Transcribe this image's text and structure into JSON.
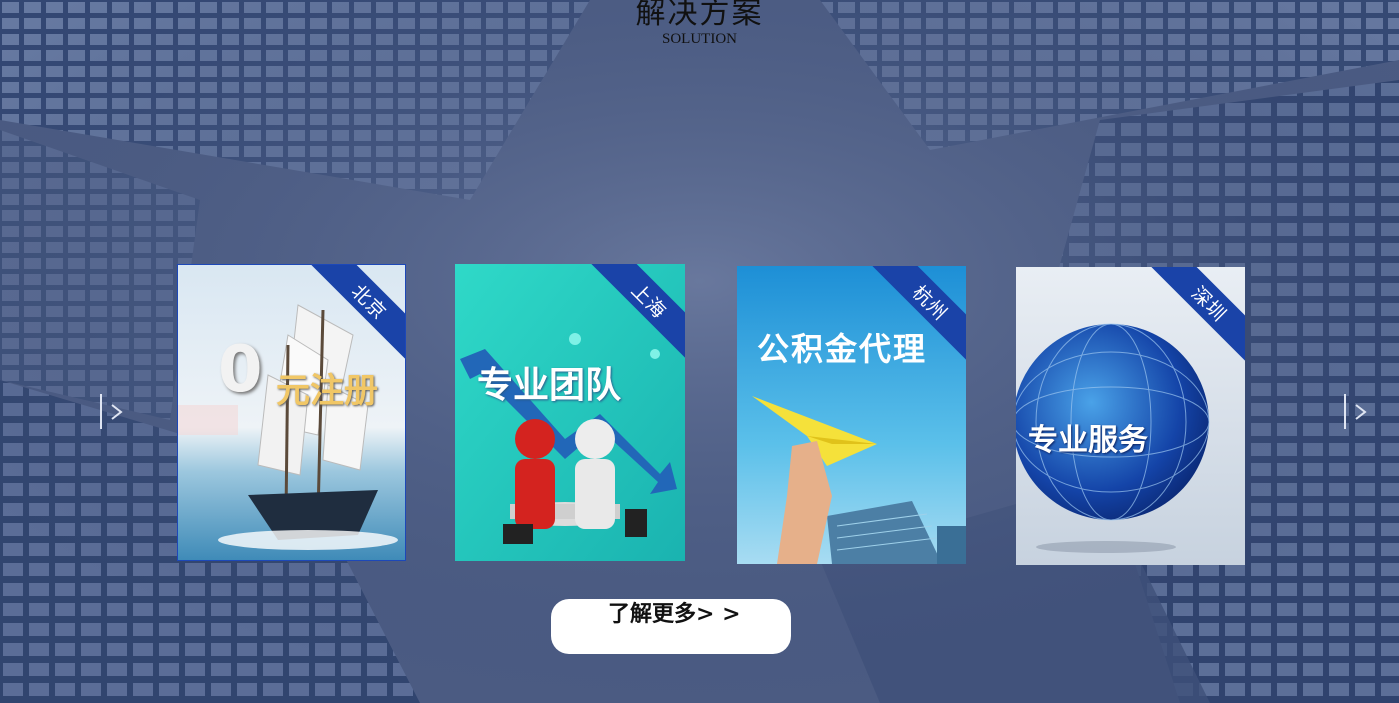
{
  "section": {
    "title": "解决方案",
    "subtitle": "SOLUTION"
  },
  "cards": [
    {
      "city": "北京",
      "caption_prefix": "0",
      "caption": "元注册"
    },
    {
      "city": "上海",
      "caption": "专业团队"
    },
    {
      "city": "杭州",
      "caption": "公积金代理"
    },
    {
      "city": "深圳",
      "caption": "专业服务"
    }
  ],
  "nav": {
    "prev_icon": "chevron-left-icon",
    "next_icon": "chevron-right-icon"
  },
  "more_button": {
    "label": "了解更多> >"
  },
  "colors": {
    "background": "#4a5a80",
    "ribbon": "#1a43a8",
    "button_bg": "#ffffff"
  }
}
